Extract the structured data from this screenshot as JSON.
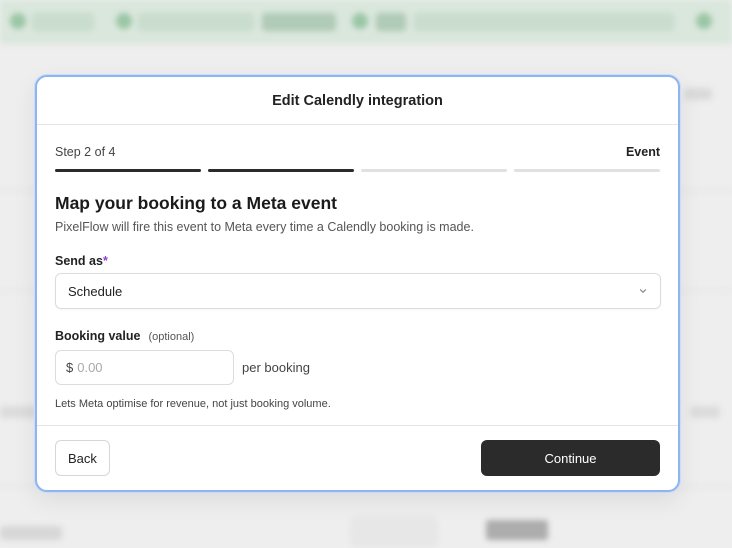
{
  "modal": {
    "title": "Edit Calendly integration",
    "step_label": "Step 2 of 4",
    "step_name": "Event",
    "steps_total": 4,
    "steps_completed": 2,
    "heading": "Map your booking to a Meta event",
    "subtext": "PixelFlow will fire this event to Meta every time a Calendly booking is made.",
    "send_as": {
      "label": "Send as",
      "required_mark": "*",
      "value": "Schedule"
    },
    "booking_value": {
      "label": "Booking value",
      "optional": "(optional)",
      "currency": "$",
      "placeholder": "0.00",
      "suffix": "per booking",
      "hint": "Lets Meta optimise for revenue, not just booking volume."
    },
    "footer": {
      "back_label": "Back",
      "continue_label": "Continue"
    }
  },
  "colors": {
    "accent_border": "#8fb4f0",
    "primary_button": "#2b2b2b",
    "required": "#8b3fd1"
  }
}
